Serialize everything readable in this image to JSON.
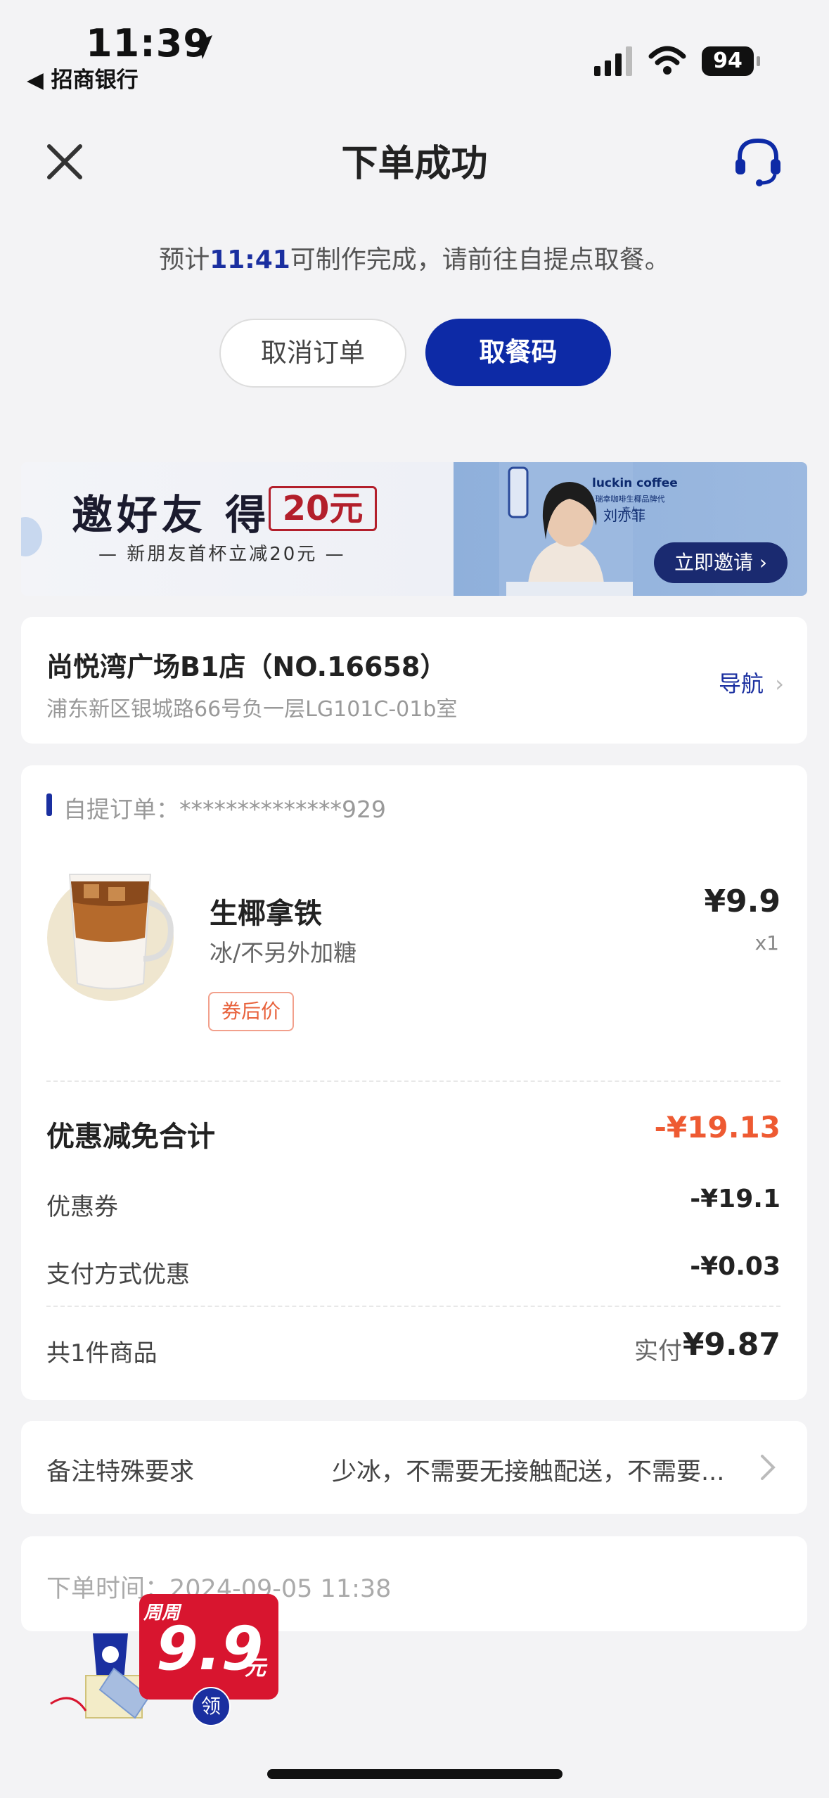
{
  "status_bar": {
    "time": "11:39",
    "back_app": "◀ 招商银行",
    "battery": "94"
  },
  "header": {
    "title": "下单成功"
  },
  "eta": {
    "prefix": "预计",
    "time": "11:41",
    "suffix": "可制作完成，请前往自提点取餐。"
  },
  "actions": {
    "cancel": "取消订单",
    "pickup_code": "取餐码"
  },
  "banner": {
    "headline": "邀好友 得",
    "amount": "20元",
    "subline": "— 新朋友首杯立减20元 —",
    "brand": "luckin coffee",
    "tagline": "瑞幸咖啡生椰品牌代言人",
    "ambassador": "刘亦菲",
    "cta": "立即邀请"
  },
  "store": {
    "name": "尚悦湾广场B1店（NO.16658）",
    "address": "浦东新区银城路66号负一层LG101C-01b室",
    "nav_label": "导航"
  },
  "order": {
    "id_label": "自提订单：",
    "id_value": "**************929",
    "item": {
      "name": "生椰拿铁",
      "options": "冰/不另外加糖",
      "tag": "券后价",
      "price": "¥9.9",
      "qty": "x1"
    },
    "discount_total_label": "优惠减免合计",
    "discount_total_value": "-¥19.13",
    "coupon_label": "优惠券",
    "coupon_value": "-¥19.1",
    "pay_discount_label": "支付方式优惠",
    "pay_discount_value": "-¥0.03",
    "count_label": "共1件商品",
    "paid_label": "实付",
    "paid_value": "¥9.87"
  },
  "note": {
    "label": "备注特殊要求",
    "value": "少冰，不需要无接触配送，不需要..."
  },
  "order_time": {
    "label": "下单时间：",
    "value": "2024-09-05 11:38"
  },
  "promo": {
    "week": "周周",
    "price": "9.9",
    "unit": "元",
    "get": "领"
  },
  "colors": {
    "primary": "#0d2aa6",
    "discount": "#ee5a32",
    "background": "#f3f3f5"
  }
}
